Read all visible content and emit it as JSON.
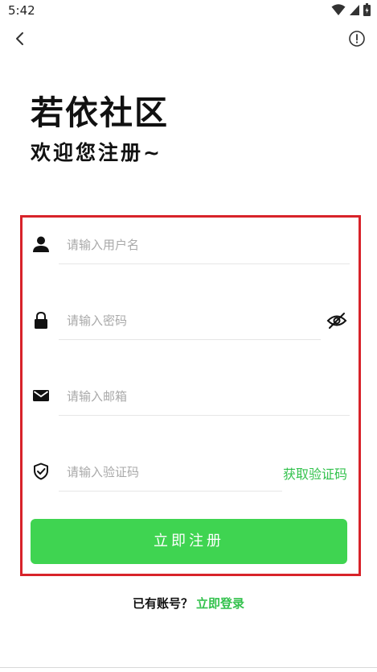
{
  "status_bar": {
    "time": "5:42",
    "icons": [
      "wifi-icon",
      "signal-icon",
      "battery-icon"
    ]
  },
  "top_bar": {
    "back_icon": "chevron-left-icon",
    "info_icon": "info-icon"
  },
  "header": {
    "title": "若依社区",
    "subtitle": "欢迎您注册~"
  },
  "form": {
    "username": {
      "placeholder": "请输入用户名",
      "value": "",
      "icon": "person-icon"
    },
    "password": {
      "placeholder": "请输入密码",
      "value": "",
      "icon": "lock-icon",
      "toggle_icon": "eye-off-icon"
    },
    "email": {
      "placeholder": "请输入邮箱",
      "value": "",
      "icon": "mail-icon"
    },
    "code": {
      "placeholder": "请输入验证码",
      "value": "",
      "icon": "shield-check-icon",
      "get_code_label": "获取验证码"
    },
    "submit_label": "立即注册"
  },
  "footer": {
    "question": "已有账号？",
    "login_link": "立即登录"
  },
  "colors": {
    "accent": "#3fd451",
    "link": "#33c24d",
    "highlight_border": "#d8232a"
  }
}
